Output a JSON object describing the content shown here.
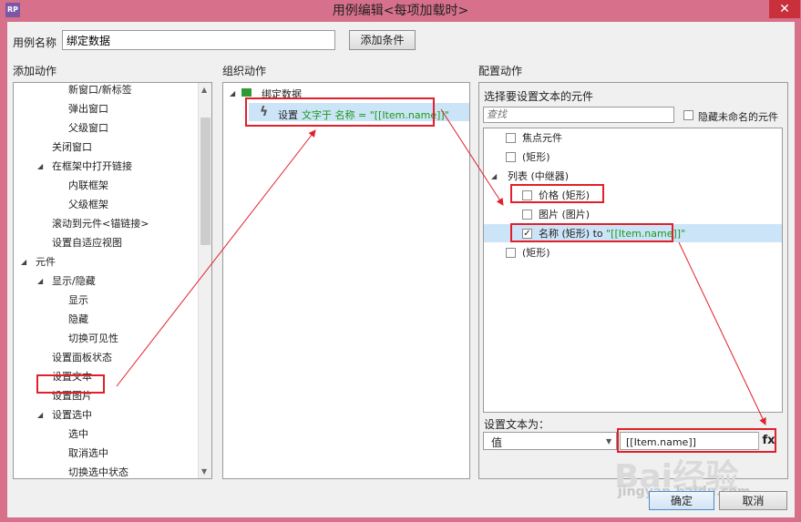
{
  "window": {
    "app_icon_label": "RP",
    "title": "用例编辑<每项加载时>",
    "close_label": "✕"
  },
  "top": {
    "case_name_label": "用例名称",
    "case_name_value": "绑定数据",
    "add_condition_button": "添加条件"
  },
  "add_actions": {
    "header": "添加动作",
    "items": [
      {
        "label": "新窗口/新标签",
        "expander": ""
      },
      {
        "label": "弹出窗口",
        "expander": ""
      },
      {
        "label": "父级窗口",
        "expander": ""
      },
      {
        "label": "关闭窗口",
        "expander": ""
      },
      {
        "label": "在框架中打开链接",
        "expander": "◢"
      },
      {
        "label": "内联框架",
        "expander": ""
      },
      {
        "label": "父级框架",
        "expander": ""
      },
      {
        "label": "滚动到元件<锚链接>",
        "expander": ""
      },
      {
        "label": "设置自适应视图",
        "expander": ""
      },
      {
        "label": "元件",
        "expander": "◢"
      },
      {
        "label": "显示/隐藏",
        "expander": "◢"
      },
      {
        "label": "显示",
        "expander": ""
      },
      {
        "label": "隐藏",
        "expander": ""
      },
      {
        "label": "切换可见性",
        "expander": ""
      },
      {
        "label": "设置面板状态",
        "expander": ""
      },
      {
        "label": "设置文本",
        "expander": ""
      },
      {
        "label": "设置图片",
        "expander": ""
      },
      {
        "label": "设置选中",
        "expander": "◢"
      },
      {
        "label": "选中",
        "expander": ""
      },
      {
        "label": "取消选中",
        "expander": ""
      },
      {
        "label": "切换选中状态",
        "expander": ""
      }
    ]
  },
  "organize_actions": {
    "header": "组织动作",
    "case_label": "绑定数据",
    "action_prefix": "设置",
    "action_green": "文字于 名称 = \"[[Item.name]]\""
  },
  "configure_actions": {
    "header": "配置动作",
    "subheader": "选择要设置文本的元件",
    "search_placeholder": "查找",
    "hide_unnamed_label": "隐藏未命名的元件",
    "widgets": [
      {
        "label": "焦点元件",
        "checked": false,
        "expander": "",
        "suffix": ""
      },
      {
        "label": "(矩形)",
        "checked": false,
        "expander": "",
        "suffix": ""
      },
      {
        "label": "列表 (中继器)",
        "checked": null,
        "expander": "◢",
        "suffix": ""
      },
      {
        "label": "价格 (矩形)",
        "checked": false,
        "expander": "",
        "suffix": ""
      },
      {
        "label": "图片 (图片)",
        "checked": false,
        "expander": "",
        "suffix": ""
      },
      {
        "label": "名称 (矩形) to ",
        "checked": true,
        "expander": "",
        "suffix": "\"[[Item.name]]\""
      },
      {
        "label": "(矩形)",
        "checked": false,
        "expander": "",
        "suffix": ""
      }
    ],
    "set_text_label": "设置文本为：",
    "value_type": "值",
    "value_text": "[[Item.name]]",
    "fx_label": "fx"
  },
  "footer": {
    "ok_button": "确定",
    "cancel_button": "取消"
  },
  "watermark": {
    "brand": "Bai经验",
    "url": "jingyan.baidu.com"
  },
  "colors": {
    "title_bar": "#d7708a",
    "annotation": "#e0202a",
    "selection": "#cce4f7",
    "green_text": "#1a9a1a"
  }
}
